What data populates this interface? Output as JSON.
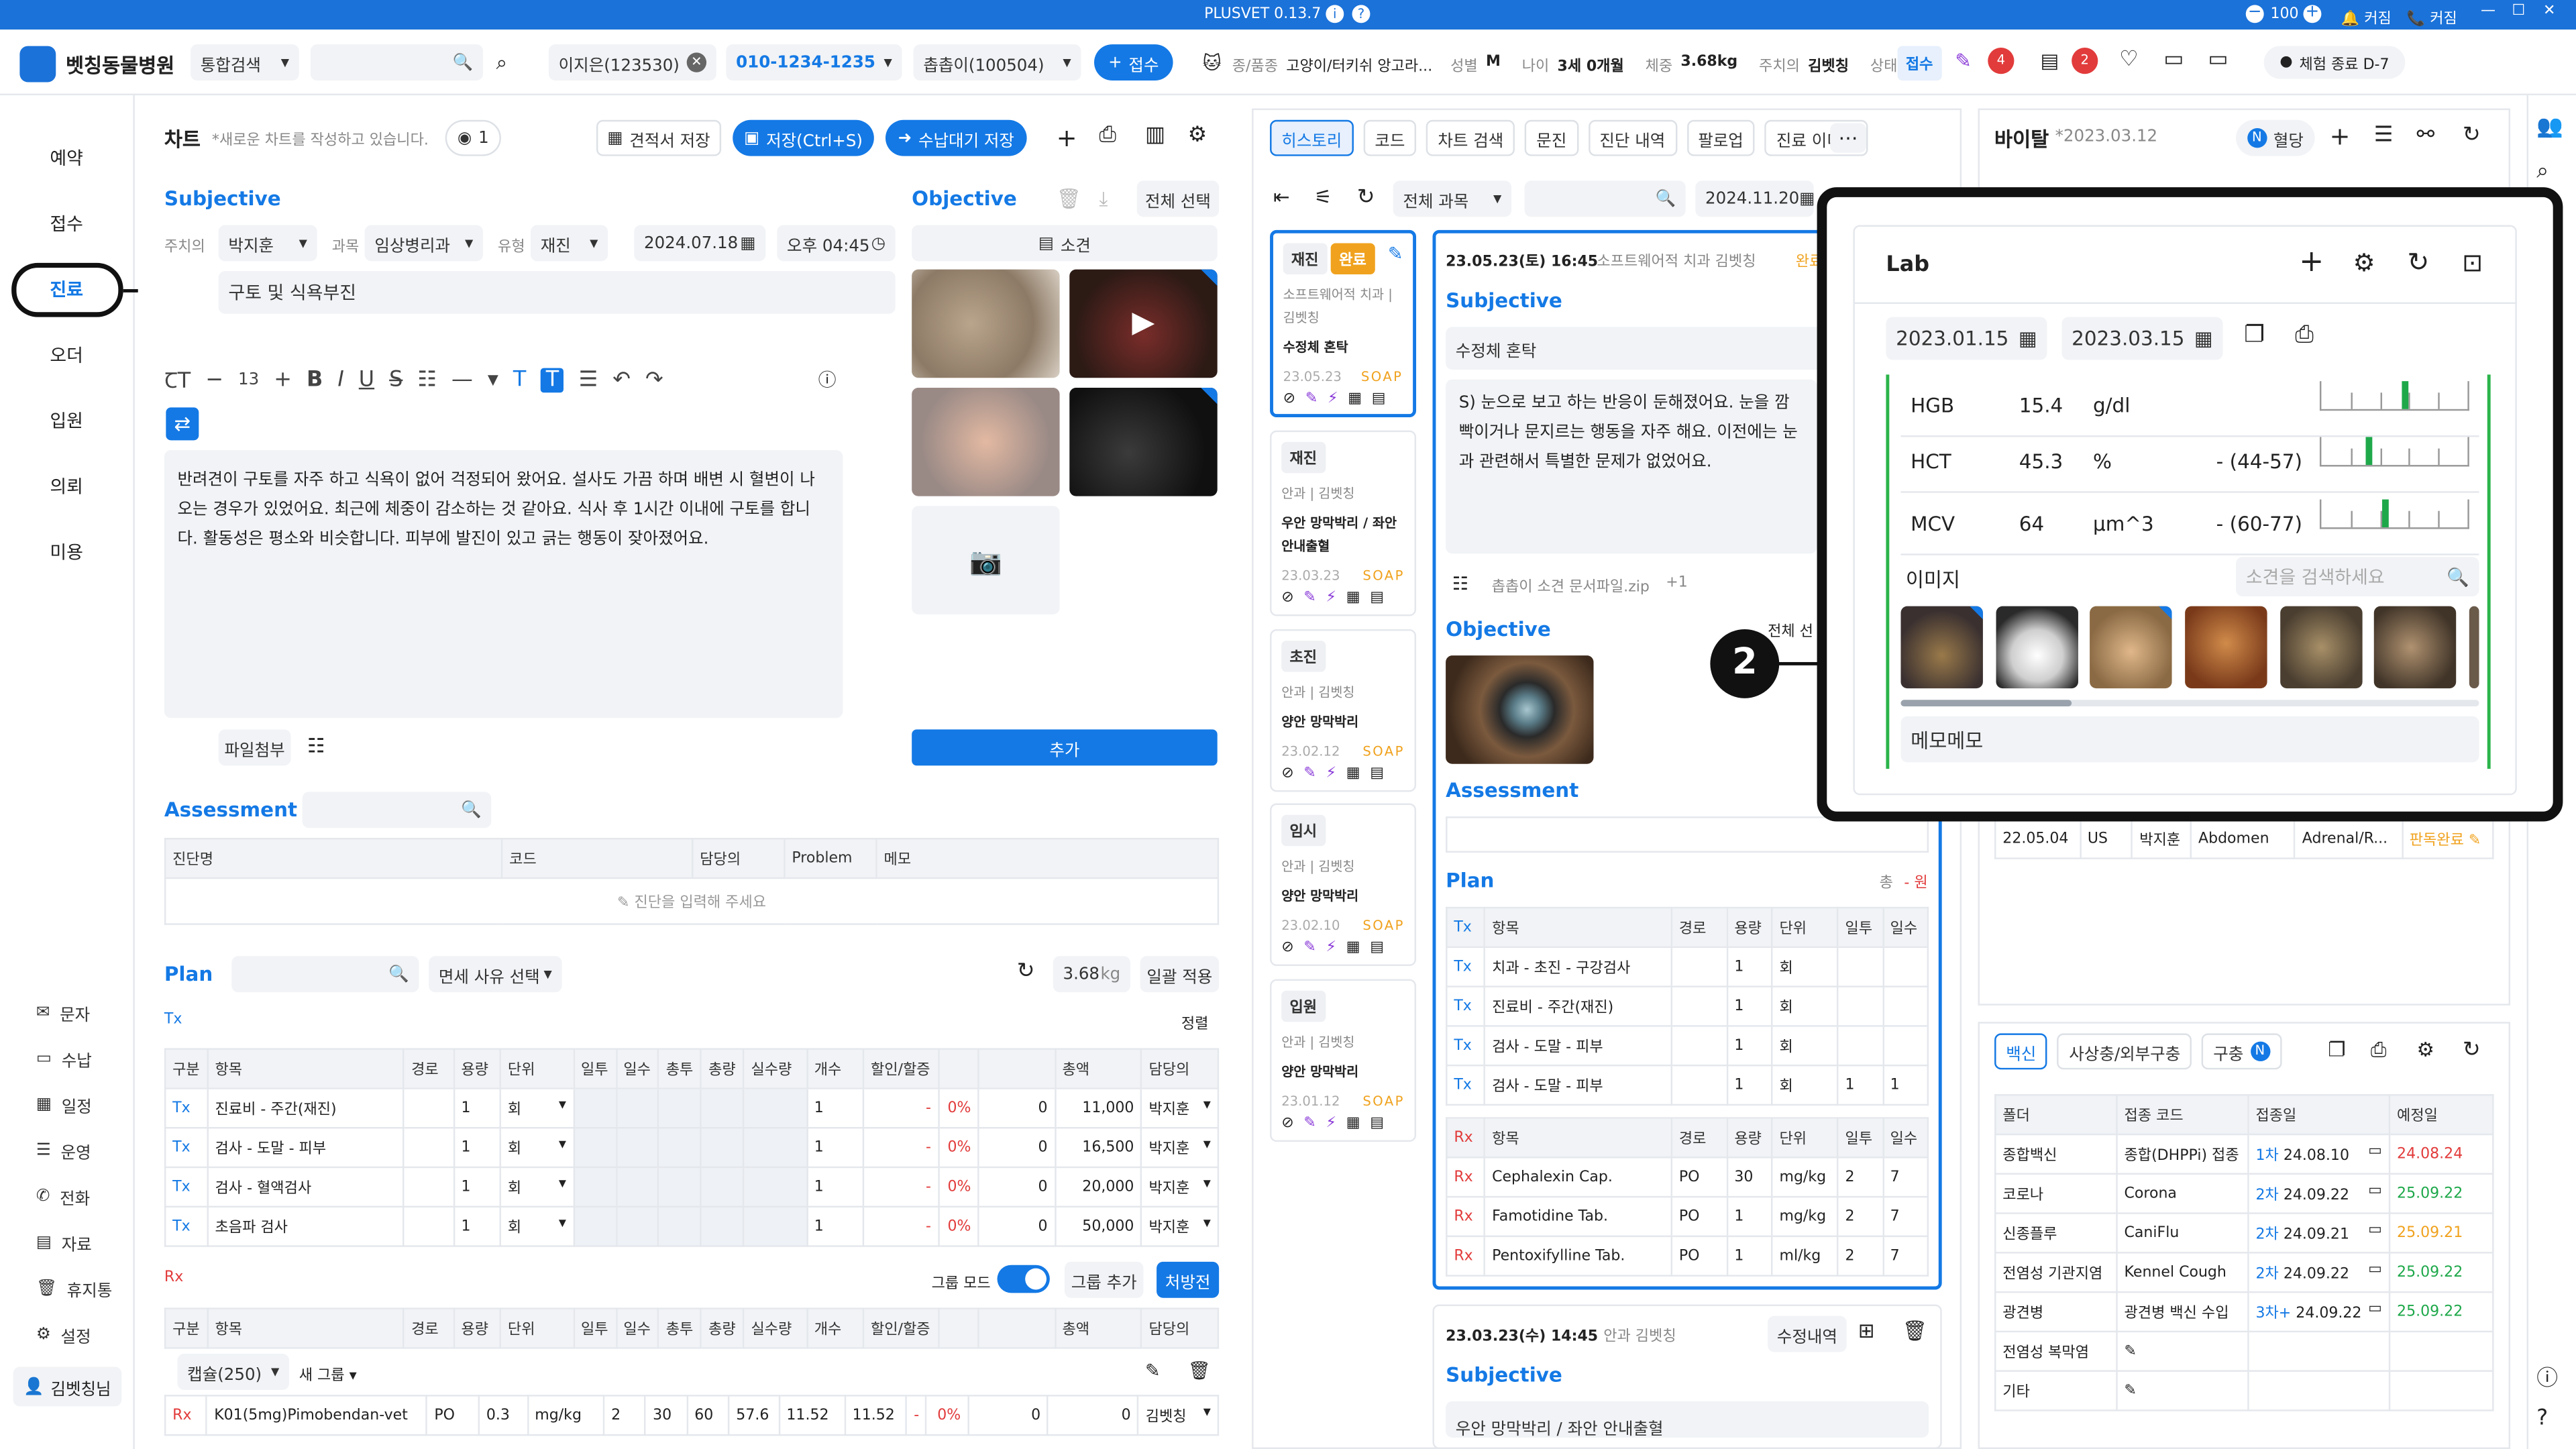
{
  "titlebar": {
    "app": "PLUSVET 0.13.7",
    "zoom": "100",
    "cursor": "커짐",
    "call": "커짐"
  },
  "topbar": {
    "clinic": "벳칭동물병원",
    "search_scope": "통합검색",
    "patient_name": "이지은(123530)",
    "phone": "010-1234-1235",
    "pet": "촙촙이(100504)",
    "reception_btn": "접수",
    "species_label": "종/품종",
    "species": "고양이/터키쉬 앙고라...",
    "sex_label": "성별",
    "sex": "M",
    "age_label": "나이",
    "age": "3세 0개월",
    "weight_label": "체중",
    "weight": "3.68kg",
    "vet_label": "주치의",
    "vet": "김벳칭",
    "status_label": "상태",
    "status": "접수",
    "badge1": "4",
    "badge2": "2",
    "trial": "체험 종료 D-7"
  },
  "sidenav": {
    "items": [
      "예약",
      "접수",
      "진료",
      "오더",
      "입원",
      "의뢰",
      "미용"
    ],
    "bottom": [
      "문자",
      "수납",
      "일정",
      "운영",
      "전화",
      "자료",
      "휴지통",
      "설정"
    ],
    "user": "김벳칭님"
  },
  "chart": {
    "title": "차트",
    "subtitle": "*새로운 차트를 작성하고 있습니다.",
    "views": "1",
    "btn_estimate": "견적서 저장",
    "btn_save": "저장(Ctrl+S)",
    "btn_wait": "수납대기 저장",
    "subjective": "Subjective",
    "vet_label": "주치의",
    "vet": "박지훈",
    "dept_label": "과목",
    "dept": "임상병리과",
    "type_label": "유형",
    "type": "재진",
    "date": "2024.07.18",
    "time": "오후 04:45",
    "chief": "구토 및 식욕부진",
    "font_size": "13",
    "note": "반려견이 구토를 자주 하고 식욕이 없어 걱정되어 왔어요. 설사도 가끔 하며 배변 시 혈변이 나오는 경우가 있었어요. 최근에 체중이 감소하는 것 같아요. 식사 후 1시간 이내에 구토를 합니다. 활동성은 평소와 비슷합니다. 피부에 발진이 있고 긁는 행동이 잦아졌어요.",
    "attach": "파일첨부",
    "objective": "Objective",
    "select_all": "전체 선택",
    "finding": "소견",
    "add": "추가",
    "assessment": "Assessment",
    "dx_headers": [
      "진단명",
      "코드",
      "담당의",
      "Problem",
      "메모"
    ],
    "dx_placeholder": "진단을 입력해 주세요",
    "plan": "Plan",
    "exempt": "면세 사유 선택",
    "plan_weight": "3.68",
    "plan_unit": "kg",
    "apply": "일괄 적용",
    "tx": "Tx",
    "sort": "정렬",
    "tx_headers": [
      "구분",
      "항목",
      "경로",
      "용량",
      "단위",
      "일투",
      "일수",
      "총투",
      "총량",
      "실수량",
      "개수",
      "할인/할증",
      "",
      "",
      "총액",
      "담당의"
    ],
    "tx_rows": [
      [
        "Tx",
        "진료비 - 주간(재진)",
        "",
        "1",
        "회",
        "",
        "",
        "",
        "",
        "",
        "1",
        "-",
        "0%",
        "0",
        "11,000",
        "박지훈"
      ],
      [
        "Tx",
        "검사 - 도말 - 피부",
        "",
        "1",
        "회",
        "",
        "",
        "",
        "",
        "",
        "1",
        "-",
        "0%",
        "0",
        "16,500",
        "박지훈"
      ],
      [
        "Tx",
        "검사 - 혈액검사",
        "",
        "1",
        "회",
        "",
        "",
        "",
        "",
        "",
        "1",
        "-",
        "0%",
        "0",
        "20,000",
        "박지훈"
      ],
      [
        "Tx",
        "초음파 검사",
        "",
        "1",
        "회",
        "",
        "",
        "",
        "",
        "",
        "1",
        "-",
        "0%",
        "0",
        "50,000",
        "박지훈"
      ]
    ],
    "rx": "Rx",
    "group_mode": "그룹 모드",
    "group_add": "그룹 추가",
    "prescribe": "처방전",
    "rx_headers": [
      "구분",
      "항목",
      "경로",
      "용량",
      "단위",
      "일투",
      "일수",
      "총투",
      "총량",
      "실수량",
      "개수",
      "할인/할증",
      "",
      "",
      "총액",
      "담당의"
    ],
    "capsule": "캡슐(250)",
    "new_group": "새 그룹",
    "rx_row": [
      "Rx",
      "K01(5mg)Pimobendan-vet",
      "PO",
      "0.3",
      "mg/kg",
      "2",
      "30",
      "60",
      "57.6",
      "11.52",
      "11.52",
      "-",
      "0%",
      "0",
      "0",
      "김벳칭"
    ]
  },
  "history": {
    "tabs": [
      "히스토리",
      "코드",
      "차트 검색",
      "문진",
      "진단 내역",
      "팔로업",
      "진료 이미지"
    ],
    "dept": "전체 과목",
    "date": "2024.11.20",
    "cards": [
      {
        "tag": "재진",
        "done": "완료",
        "sub": "소프트웨어적 치과 | 김벳칭",
        "title": "수정체 혼탁",
        "date": "23.05.23",
        "soap": "SOAP"
      },
      {
        "tag": "재진",
        "sub": "안과 | 김벳칭",
        "title": "우안 망막박리 / 좌안 안내출혈",
        "date": "23.03.23",
        "soap": "SOAP"
      },
      {
        "tag": "초진",
        "sub": "안과 | 김벳칭",
        "title": "양안 망막박리",
        "date": "23.02.12",
        "soap": "SOAP"
      },
      {
        "tag": "임시",
        "sub": "안과 | 김벳칭",
        "title": "양안 망막박리",
        "date": "23.02.10",
        "soap": "SOAP"
      },
      {
        "tag": "입원",
        "sub": "안과 | 김벳칭",
        "title": "양안 망막박리",
        "date": "23.01.12",
        "soap": "SOAP"
      }
    ],
    "detail_date": "23.05.23(토) 16:45",
    "detail_meta": "소프트웨어적 치과 김벳칭",
    "detail_status": "완료",
    "subjective": "Subjective",
    "chief": "수정체 혼탁",
    "note": "S) 눈으로 보고 하는 반응이 둔해졌어요. 눈을 깜빡이거나 문지르는 행동을 자주 해요. 이전에는 눈과 관련해서 특별한 문제가 없었어요.",
    "file": "촙촙이 소견 문서파일.zip",
    "file_more": "+1",
    "objective": "Objective",
    "select_all": "전체 선",
    "assessment": "Assessment",
    "plan": "Plan",
    "plan_total": "총",
    "plan_total_val": "- 원",
    "tx_headers": [
      "항목",
      "경로",
      "용량",
      "단위",
      "일투",
      "일수"
    ],
    "tx_rows": [
      [
        "Tx",
        "치과 - 초진 - 구강검사",
        "",
        "1",
        "회",
        "",
        ""
      ],
      [
        "Tx",
        "진료비 - 주간(재진)",
        "",
        "1",
        "회",
        "",
        ""
      ],
      [
        "Tx",
        "검사 - 도말 - 피부",
        "",
        "1",
        "회",
        "",
        ""
      ],
      [
        "Tx",
        "검사 - 도말 - 피부",
        "",
        "1",
        "회",
        "1",
        "1"
      ]
    ],
    "rx_rows": [
      [
        "Rx",
        "Cephalexin Cap.",
        "PO",
        "30",
        "mg/kg",
        "2",
        "7"
      ],
      [
        "Rx",
        "Famotidine Tab.",
        "PO",
        "1",
        "mg/kg",
        "2",
        "7"
      ],
      [
        "Rx",
        "Pentoxifylline Tab.",
        "PO",
        "1",
        "ml/kg",
        "2",
        "7"
      ]
    ],
    "detail2_date": "23.03.23(수) 14:45",
    "detail2_meta": "안과 김벳칭",
    "detail2_btn": "수정내역",
    "subjective2": "Subjective",
    "chief2": "우안 망막박리 / 좌안 안내출혈"
  },
  "vital": {
    "title": "바이탈",
    "date": "*2023.03.12",
    "toggle": "혈당"
  },
  "lab": {
    "title": "Lab",
    "from": "2023.01.15",
    "to": "2023.03.15",
    "rows": [
      {
        "name": "HGB",
        "val": "15.4",
        "unit": "g/dl",
        "range": "",
        "level": 0.55
      },
      {
        "name": "HCT",
        "val": "45.3",
        "unit": "%",
        "range": "- (44-57)",
        "level": 0.3
      },
      {
        "name": "MCV",
        "val": "64",
        "unit": "μm^3",
        "range": "- (60-77)",
        "level": 0.42
      }
    ],
    "image_label": "이미지",
    "search_placeholder": "소견을 검색하세요",
    "memo": "메모메모"
  },
  "imaging": {
    "row": [
      "22.05.04",
      "US",
      "박지훈",
      "Abdomen",
      "Adrenal/R...",
      "판독완료"
    ]
  },
  "vaccine": {
    "tabs": [
      "백신",
      "사상충/외부구충",
      "구충"
    ],
    "tab3_badge": "N",
    "headers": [
      "폴더",
      "접종 코드",
      "접종일",
      "예정일"
    ],
    "rows": [
      [
        "종합백신",
        "종합(DHPPi) 접종",
        "1차",
        "24.08.10",
        "24.08.24"
      ],
      [
        "코로나",
        "Corona",
        "2차",
        "24.09.22",
        "25.09.22"
      ],
      [
        "신종플루",
        "CaniFlu",
        "2차",
        "24.09.21",
        "25.09.21"
      ],
      [
        "전염성 기관지염",
        "Kennel Cough",
        "2차",
        "24.09.22",
        "25.09.22"
      ],
      [
        "광견병",
        "광견병 백신 수입",
        "3차+",
        "24.09.22",
        "25.09.22"
      ],
      [
        "전염성 복막염",
        "",
        "",
        "",
        ""
      ],
      [
        "기타",
        "",
        "",
        "",
        ""
      ]
    ]
  },
  "callouts": [
    "1",
    "2"
  ],
  "colors": {
    "accent": "#1479e5",
    "danger": "#e23b3b",
    "warn": "#f0a21e",
    "ok": "#1ea84a"
  }
}
